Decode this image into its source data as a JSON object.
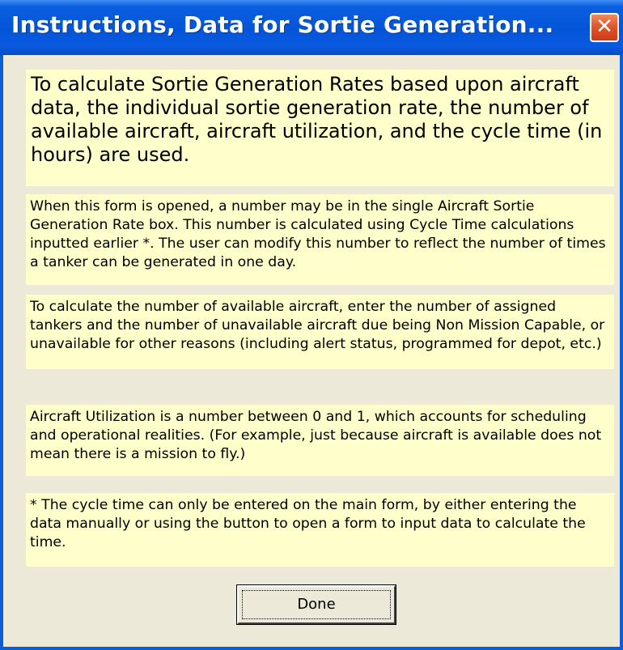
{
  "window": {
    "title": "Instructions, Data for Sortie Generation...",
    "close_glyph": "✕",
    "close_icon": "close-icon"
  },
  "notes": [
    "To calculate Sortie Generation Rates based upon aircraft data, the individual sortie generation rate, the number of available aircraft, aircraft utilization, and the cycle time (in hours) are used.",
    "When this form is opened, a number may be in the single Aircraft Sortie Generation Rate box.  This number is calculated using Cycle Time calculations inputted earlier *.  The user can modify this number to reflect the number of times a tanker can be generated in one day.",
    "To calculate the number of available aircraft, enter the number of assigned tankers and the number of unavailable aircraft due being Non Mission Capable, or unavailable for other reasons (including alert status, programmed for depot, etc.)",
    "Aircraft Utilization is a number between 0 and 1, which accounts for scheduling and operational realities.  (For example, just because aircraft is available does not mean there is a mission to fly.)",
    "* The cycle time can only be entered on the main form, by either entering the data manually or using the button to open a form to input data to calculate the time."
  ],
  "buttons": {
    "done_label": "Done"
  },
  "colors": {
    "title_bar": "#0554d8",
    "close_button": "#e0522a",
    "note_background": "#ffffcc",
    "dialog_background": "#ece9d8"
  }
}
